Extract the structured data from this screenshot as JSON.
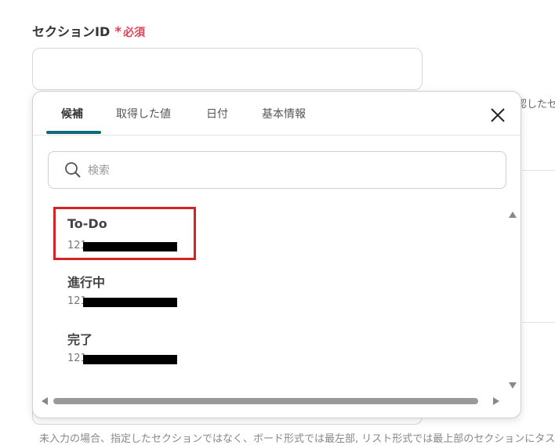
{
  "field": {
    "label": "セクションID",
    "required_star": "*",
    "required_text": "必須"
  },
  "background": {
    "right_text": "認したセ",
    "bottom_text": "未入力の場合、指定したセクションではなく、ボード形式では最左部, リスト形式では最上部のセクションにタス"
  },
  "popup": {
    "tabs": [
      {
        "label": "候補",
        "active": true
      },
      {
        "label": "取得した値",
        "active": false
      },
      {
        "label": "日付",
        "active": false
      },
      {
        "label": "基本情報",
        "active": false
      }
    ],
    "close_icon": "close-icon",
    "search": {
      "placeholder": "検索",
      "value": "",
      "icon": "search-icon"
    },
    "options": [
      {
        "title": "To-Do",
        "id_prefix": "121",
        "highlighted": true
      },
      {
        "title": "進行中",
        "id_prefix": "121",
        "highlighted": false
      },
      {
        "title": "完了",
        "id_prefix": "121",
        "highlighted": false
      }
    ]
  },
  "colors": {
    "required": "#e0445a",
    "tab_accent": "#0f6b7a",
    "highlight": "#d42323"
  }
}
